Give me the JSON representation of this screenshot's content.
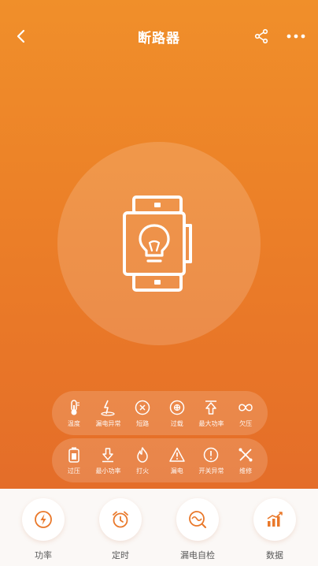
{
  "header": {
    "title": "断路器",
    "back_icon": "chevron-left-icon",
    "share_icon": "share-icon",
    "more_icon": "more-dots-icon"
  },
  "device": {
    "icon": "breaker-bulb-icon"
  },
  "status_row_1": [
    {
      "label": "温度",
      "icon": "thermometer-icon"
    },
    {
      "label": "漏电异常",
      "icon": "leakage-icon"
    },
    {
      "label": "短路",
      "icon": "short-circuit-icon"
    },
    {
      "label": "过载",
      "icon": "overload-icon"
    },
    {
      "label": "最大功率",
      "icon": "max-power-icon"
    },
    {
      "label": "欠压",
      "icon": "undervoltage-icon"
    }
  ],
  "status_row_2": [
    {
      "label": "过压",
      "icon": "overvoltage-icon"
    },
    {
      "label": "最小功率",
      "icon": "min-power-icon"
    },
    {
      "label": "打火",
      "icon": "fire-icon"
    },
    {
      "label": "漏电",
      "icon": "warning-icon"
    },
    {
      "label": "开关异常",
      "icon": "switch-error-icon"
    },
    {
      "label": "维修",
      "icon": "repair-icon"
    }
  ],
  "toolbar": [
    {
      "label": "功率",
      "icon": "power-icon"
    },
    {
      "label": "定时",
      "icon": "alarm-clock-icon"
    },
    {
      "label": "漏电自检",
      "icon": "leakage-test-icon"
    },
    {
      "label": "数据",
      "icon": "chart-icon"
    }
  ],
  "colors": {
    "accent": "#e9782a",
    "hero_top": "#f08f2a",
    "hero_bottom": "#e46d29",
    "toolbar_bg": "#fbf8f6"
  }
}
